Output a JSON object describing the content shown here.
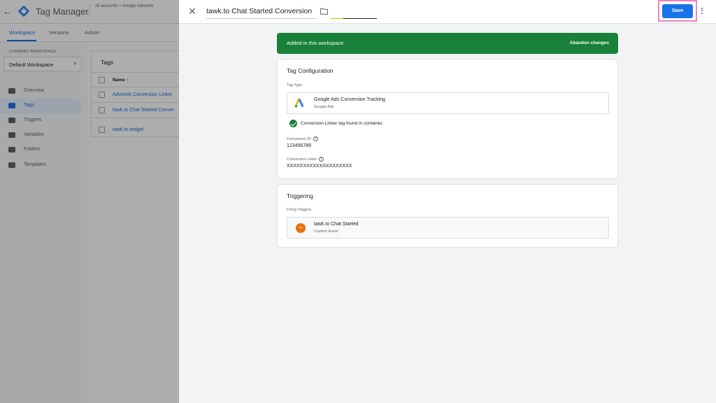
{
  "background": {
    "back_arrow": "←",
    "product_name": "Tag Manager",
    "breadcrumb": "All accounts > Google Adwords",
    "tabs": [
      "Workspace",
      "Versions",
      "Admin"
    ],
    "current_workspace_label": "CURRENT WORKSPACE",
    "workspace_name": "Default Workspace",
    "workspace_chevron": "›",
    "nav": [
      "Overview",
      "Tags",
      "Triggers",
      "Variables",
      "Folders",
      "Templates"
    ],
    "tags_card_title": "Tags",
    "name_column": "Name ↑",
    "tag_rows": [
      "Adwords Conversion Linker",
      "tawk.to Chat Started Conver",
      "tawk.to widget"
    ]
  },
  "panel": {
    "close_icon": "✕",
    "title": "tawk.to Chat Started Conversion",
    "save_label": "Save",
    "banner_text": "Added in this workspace",
    "banner_action": "Abandon changes",
    "tag_config": {
      "title": "Tag Configuration",
      "tag_type_label": "Tag Type",
      "tag_type_name": "Google Ads Conversion Tracking",
      "tag_type_vendor": "Google Ads",
      "linker_message": "Conversion Linker tag found in container.",
      "conversion_id_label": "Conversion ID",
      "conversion_id_value": "123456789",
      "conversion_label_label": "Conversion Label",
      "conversion_label_value": "XXXXXXXXXXXXXXXXXXXX",
      "help_glyph": "?"
    },
    "triggering": {
      "title": "Triggering",
      "firing_label": "Firing Triggers",
      "trigger_name": "tawk.to Chat Started",
      "trigger_type": "Custom Event",
      "trigger_glyph": "‹›"
    }
  },
  "colors": {
    "primary": "#1a73e8",
    "success": "#188038",
    "highlight": "#ee82c5",
    "event": "#e8710a"
  }
}
